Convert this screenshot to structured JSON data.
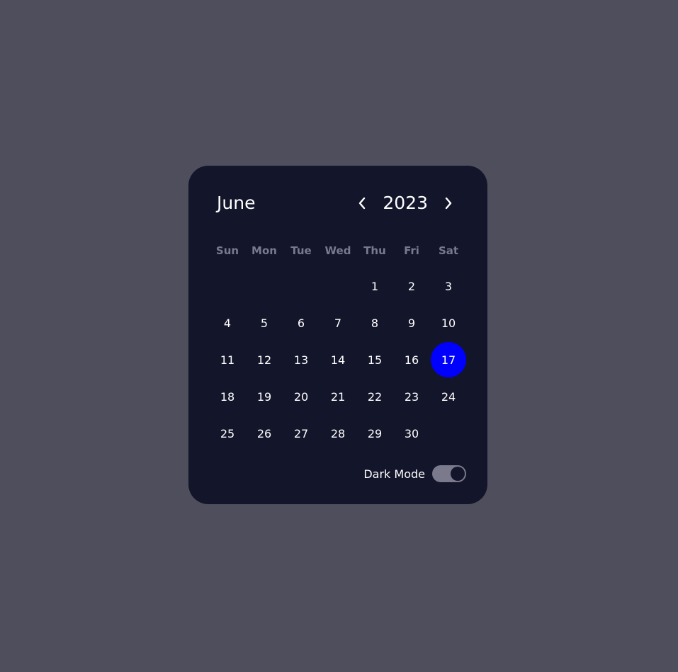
{
  "calendar": {
    "month": "June",
    "year": "2023",
    "weekdays": [
      "Sun",
      "Mon",
      "Tue",
      "Wed",
      "Thu",
      "Fri",
      "Sat"
    ],
    "leading_blanks": 4,
    "days": [
      "1",
      "2",
      "3",
      "4",
      "5",
      "6",
      "7",
      "8",
      "9",
      "10",
      "11",
      "12",
      "13",
      "14",
      "15",
      "16",
      "17",
      "18",
      "19",
      "20",
      "21",
      "22",
      "23",
      "24",
      "25",
      "26",
      "27",
      "28",
      "29",
      "30"
    ],
    "selected_day": "17",
    "prev_icon": "chevron-left-icon",
    "next_icon": "chevron-right-icon"
  },
  "dark_mode": {
    "label": "Dark Mode",
    "enabled": true
  },
  "colors": {
    "page_background": "#4f4e5c",
    "card_background": "#13152a",
    "selected": "#0000ff",
    "weekday_text": "#777a90",
    "toggle_track": "#7b7a8c"
  }
}
